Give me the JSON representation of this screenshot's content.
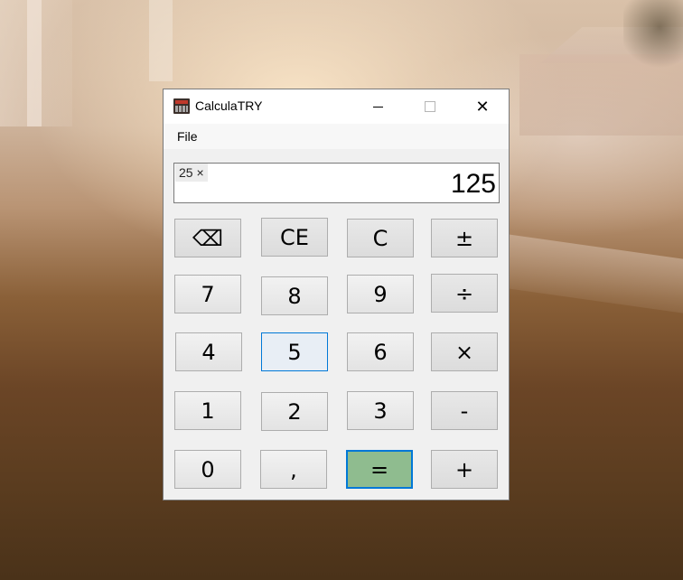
{
  "window": {
    "title": "CalculaTRY",
    "minimize": "",
    "maximize": "",
    "close": "✕"
  },
  "menu": {
    "file": "File"
  },
  "display": {
    "expression": "25 ×",
    "value": "125"
  },
  "keys": {
    "backspace": "⌫",
    "ce": "CE",
    "c": "C",
    "plusminus": "±",
    "k7": "7",
    "k8": "8",
    "k9": "9",
    "divide": "÷",
    "k4": "4",
    "k5": "5",
    "k6": "6",
    "multiply": "×",
    "k1": "1",
    "k2": "2",
    "k3": "3",
    "minus": "-",
    "k0": "0",
    "decimal": ",",
    "equals": "=",
    "plus": "+"
  },
  "colors": {
    "equals_bg": "#8fbc8f",
    "focus_border": "#0078d7"
  }
}
